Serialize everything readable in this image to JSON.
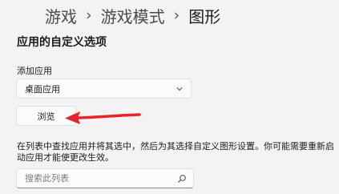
{
  "breadcrumb": {
    "items": [
      "游戏",
      "游戏模式",
      "图形"
    ],
    "separator": "›"
  },
  "section_title": "应用的自定义选项",
  "add_app": {
    "label": "添加应用",
    "selected": "桌面应用"
  },
  "browse_label": "浏览",
  "description": "在列表中查找应用并将其选中，然后为其选择自定义图形设置。你可能需要重新启动应用才能使更改生效。",
  "search": {
    "placeholder": "搜索此列表",
    "value": ""
  },
  "icons": {
    "select_chevron": "chevron-down-icon",
    "search": "search-icon",
    "annotation": "red-arrow-icon"
  },
  "colors": {
    "background": "#f3f3f3",
    "control_bg": "#fbfbfb",
    "arrow": "#e8232a"
  }
}
